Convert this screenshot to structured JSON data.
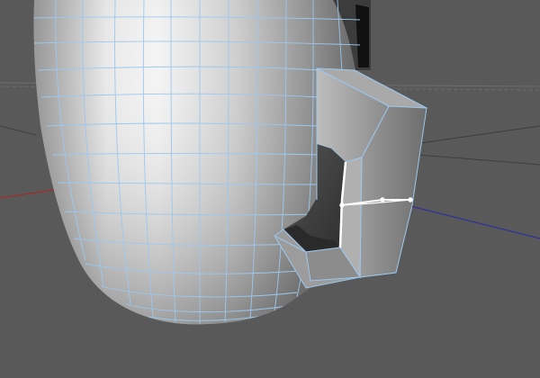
{
  "viewport": {
    "background_color": "#595959",
    "grid_line_color": "#6b6b6b",
    "x_axis_color": "#b22222",
    "z_axis_color": "#2a2aa8",
    "mesh_wire_color": "#9cc8ee",
    "selected_edge_color": "#ffffff",
    "object": "mug-with-handle",
    "mode": "edge-selection"
  }
}
